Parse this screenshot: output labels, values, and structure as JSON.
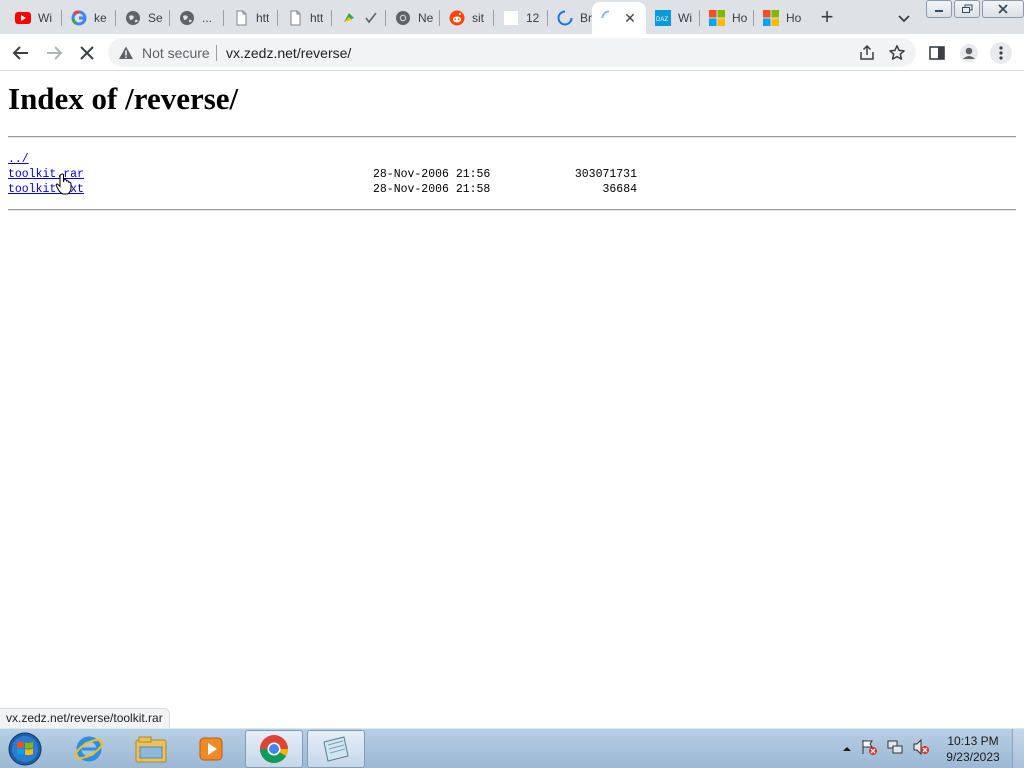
{
  "browser": {
    "tabs": [
      {
        "title": "Wi",
        "icon": "youtube-icon"
      },
      {
        "title": "ke",
        "icon": "google-icon"
      },
      {
        "title": "Se",
        "icon": "globe-icon"
      },
      {
        "title": "...",
        "icon": "globe-icon"
      },
      {
        "title": "htt",
        "icon": "document-icon"
      },
      {
        "title": "htt",
        "icon": "document-icon"
      },
      {
        "title": "",
        "icon": "extension-icon"
      },
      {
        "title": "Ne",
        "icon": "chrome-icon"
      },
      {
        "title": "sit",
        "icon": "reddit-icon"
      },
      {
        "title": "12",
        "icon": "blank-page-icon"
      },
      {
        "title": "Bri",
        "icon": "loading-spinner-icon"
      },
      {
        "title": "",
        "icon": "loading-spinner-icon",
        "active": true
      },
      {
        "title": "Wi",
        "icon": "dazn-icon"
      },
      {
        "title": "Ho",
        "icon": "microsoft-icon"
      },
      {
        "title": "Ho",
        "icon": "microsoft-icon"
      }
    ],
    "security_label": "Not secure",
    "url": "vx.zedz.net/reverse/",
    "status_url": "vx.zedz.net/reverse/toolkit.rar"
  },
  "page": {
    "heading": "Index of /reverse/",
    "entries": [
      {
        "name": "../",
        "date": "",
        "size": ""
      },
      {
        "name": "toolkit.rar",
        "date": "28-Nov-2006 21:56",
        "size": "303071731"
      },
      {
        "name": "toolkit.txt",
        "date": "28-Nov-2006 21:58",
        "size": "36684"
      }
    ]
  },
  "taskbar": {
    "time": "10:13 PM",
    "date": "9/23/2023"
  },
  "colors": {
    "link": "#0000ee",
    "tabstrip": "#dee1e6",
    "omnibox": "#f1f3f4"
  }
}
